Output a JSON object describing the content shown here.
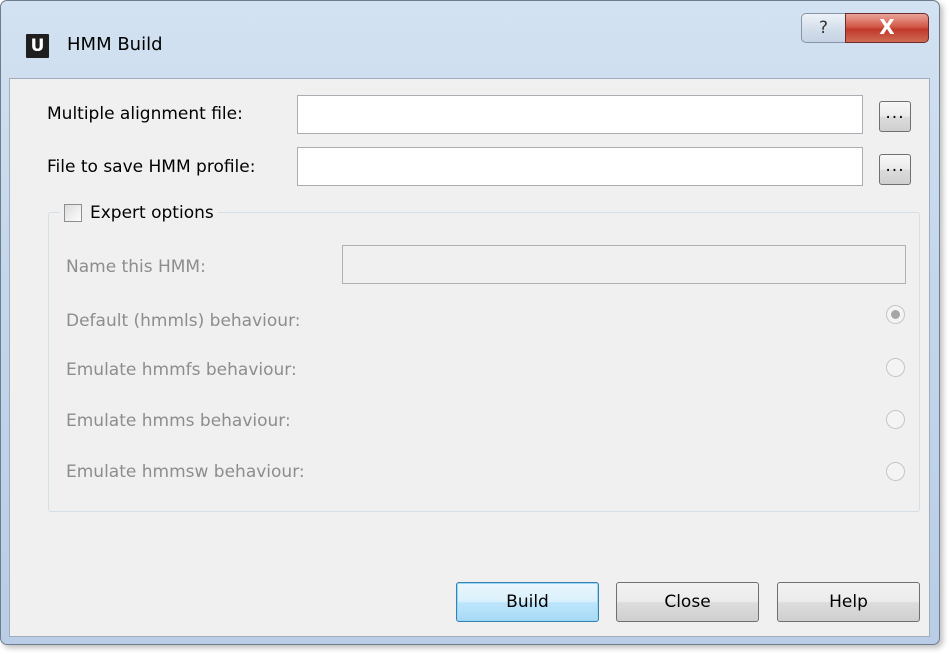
{
  "window": {
    "app_icon_letter": "U",
    "title": "HMM Build",
    "help_caption": "?",
    "close_caption": "X"
  },
  "form": {
    "alignment_label": "Multiple alignment file:",
    "alignment_value": "",
    "save_label": "File to save HMM profile:",
    "save_value": "",
    "browse_label": "..."
  },
  "expert": {
    "checkbox_label": "Expert options",
    "checked": false,
    "name_label": "Name this HMM:",
    "name_value": "",
    "options": [
      {
        "label": "Default (hmmls) behaviour:",
        "selected": true
      },
      {
        "label": "Emulate hmmfs behaviour:",
        "selected": false
      },
      {
        "label": "Emulate hmms behaviour:",
        "selected": false
      },
      {
        "label": "Emulate hmmsw behaviour:",
        "selected": false
      }
    ]
  },
  "buttons": {
    "build": "Build",
    "close": "Close",
    "help": "Help"
  },
  "colors": {
    "client_bg": "#f0f0f0",
    "disabled_text": "#8d8d8d",
    "default_button_border": "#3c7fb1"
  }
}
